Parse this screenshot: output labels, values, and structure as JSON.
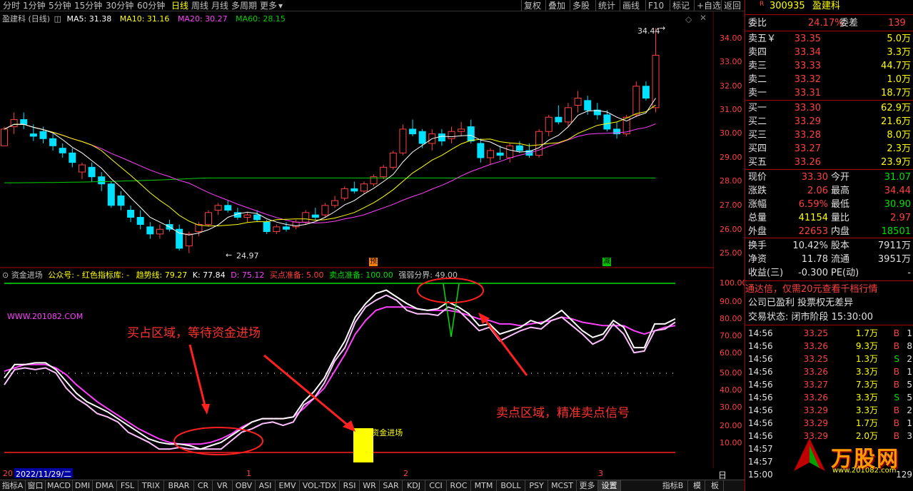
{
  "toolbar": {
    "periods": [
      "分时",
      "1分钟",
      "5分钟",
      "15分钟",
      "30分钟",
      "60分钟",
      "日线",
      "周线",
      "月线",
      "多周期",
      "更多"
    ],
    "active_period": "日线",
    "buttons": [
      "复权",
      "叠加",
      "多股",
      "统计",
      "画线",
      "F10",
      "标记",
      "+自选",
      "返回"
    ]
  },
  "chart_title": {
    "name": "盈建科 (日线)",
    "ma5": "MA5: 31.38",
    "ma10": "MA10: 31.16",
    "ma20": "MA20: 30.27",
    "ma60": "MA60: 28.15",
    "high_mark": "34.44",
    "low_mark": "24.97",
    "badge_pre": "预",
    "badge_cut": "减"
  },
  "colors": {
    "up": "#ff4040",
    "down": "#00e0ff",
    "ma5": "#ffffff",
    "ma10": "#ffff00",
    "ma20": "#ff40ff",
    "ma60": "#00d000"
  },
  "indicator": {
    "name": "资金进场",
    "author": "公众号: - 红色指标库: -",
    "trend": "趋势线: 79.27",
    "k": "K: 77.84",
    "d": "D: 75.12",
    "sell_prep": "买点准备: 5.00",
    "buy_prep": "卖点准备: 100.00",
    "strength": "强弱分界: 49.00",
    "watermark": "WWW.201082.COM",
    "annotation_buy": "买占区域，等待资金进场",
    "annotation_sell": "卖点区域，精准卖点信号",
    "signal_label": "资金进场"
  },
  "yaxis_price": [
    "34.00",
    "33.00",
    "32.00",
    "31.00",
    "30.00",
    "29.00",
    "28.00",
    "27.00",
    "26.00",
    "25.00"
  ],
  "yaxis_ind": [
    "100.00",
    "90.00",
    "80.00",
    "70.00",
    "60.00",
    "50.00",
    "40.00",
    "30.00",
    "20.00",
    "10.00"
  ],
  "datebar": {
    "prefix": "20",
    "date": "2022/11/29/二",
    "marks": [
      "1",
      "2",
      "3"
    ],
    "period_btn": "日线"
  },
  "bottom_tabs": [
    "指标A",
    "窗口",
    "MACD",
    "DMI",
    "DMA",
    "FSL",
    "TRIX",
    "BRAR",
    "CR",
    "VR",
    "OBV",
    "ASI",
    "EMV",
    "VOL-TDX",
    "RSI",
    "WR",
    "SAR",
    "KDJ",
    "CCI",
    "ROC",
    "MTM",
    "BOLL",
    "PSY",
    "MCST",
    "更多",
    "设置"
  ],
  "bottom_right_tabs": [
    "指标B",
    "模",
    "板"
  ],
  "quote": {
    "r_badge": "R",
    "code": "300935",
    "name": "盈建科",
    "weibi_label": "委比",
    "weibi": "24.17%",
    "weicha_label": "委差",
    "weicha": "139",
    "sells": [
      {
        "label": "卖五￥",
        "price": "33.35",
        "vol": "5.0万"
      },
      {
        "label": "卖四",
        "price": "33.34",
        "vol": "3.3万"
      },
      {
        "label": "卖三",
        "price": "33.33",
        "vol": "44.7万"
      },
      {
        "label": "卖二",
        "price": "33.32",
        "vol": "1.0万"
      },
      {
        "label": "卖一",
        "price": "33.31",
        "vol": "18.7万"
      }
    ],
    "buys": [
      {
        "label": "买一",
        "price": "33.30",
        "vol": "62.9万"
      },
      {
        "label": "买二",
        "price": "33.29",
        "vol": "21.6万"
      },
      {
        "label": "买三",
        "price": "33.28",
        "vol": "8.0万"
      },
      {
        "label": "买四",
        "price": "33.27",
        "vol": "2.3万"
      },
      {
        "label": "买五",
        "price": "33.26",
        "vol": "23.9万"
      }
    ],
    "stats": [
      {
        "l1": "现价",
        "v1": "33.30",
        "l2": "今开",
        "v2": "31.07"
      },
      {
        "l1": "涨跌",
        "v1": "2.06",
        "l2": "最高",
        "v2": "34.44"
      },
      {
        "l1": "涨幅",
        "v1": "6.59%",
        "l2": "最低",
        "v2": "30.90"
      },
      {
        "l1": "总量",
        "v1": "41154",
        "l2": "量比",
        "v2": "2.97"
      },
      {
        "l1": "外盘",
        "v1": "22653",
        "l2": "内盘",
        "v2": "18501"
      }
    ],
    "stats2": [
      {
        "l1": "换手",
        "v1": "10.42%",
        "l2": "股本",
        "v2": "7911万"
      },
      {
        "l1": "净资",
        "v1": "11.78",
        "l2": "流通",
        "v2": "3951万"
      },
      {
        "l1": "收益(三)",
        "v1": "-0.300",
        "l2": "PE(动)",
        "v2": "-"
      }
    ],
    "notice": "通达信，仅需20元查看千档行情",
    "profit": "公司已盈利 投票权无差异",
    "trade_status": "交易状态: 闭市阶段 15:30:00",
    "ticks": [
      {
        "t": "14:56",
        "p": "33.25",
        "v": "1.7万",
        "s": "B",
        "n": "1"
      },
      {
        "t": "14:56",
        "p": "33.26",
        "v": "9.3万",
        "s": "B",
        "n": "8"
      },
      {
        "t": "14:56",
        "p": "33.25",
        "v": "1.3万",
        "s": "S",
        "n": "2"
      },
      {
        "t": "14:56",
        "p": "33.26",
        "v": "3.3万",
        "s": "B",
        "n": "1"
      },
      {
        "t": "14:56",
        "p": "33.27",
        "v": "7.3万",
        "s": "B",
        "n": "5"
      },
      {
        "t": "14:56",
        "p": "33.26",
        "v": "3.3万",
        "s": "S",
        "n": "5"
      },
      {
        "t": "14:56",
        "p": "33.29",
        "v": "3.3万",
        "s": "B",
        "n": "2"
      },
      {
        "t": "14:56",
        "p": "33.29",
        "v": "1.7万",
        "s": "B",
        "n": "1"
      },
      {
        "t": "14:56",
        "p": "33.29",
        "v": "2.0万",
        "s": "B",
        "n": "3"
      },
      {
        "t": "14:57",
        "p": "",
        "v": "",
        "s": "",
        "n": ""
      },
      {
        "t": "14:57",
        "p": "",
        "v": "",
        "s": "",
        "n": ""
      },
      {
        "t": "15:00",
        "p": "",
        "v": "",
        "s": "",
        "n": "129"
      }
    ],
    "logo_text": "万股网",
    "logo_url": "www.201082.com"
  }
}
